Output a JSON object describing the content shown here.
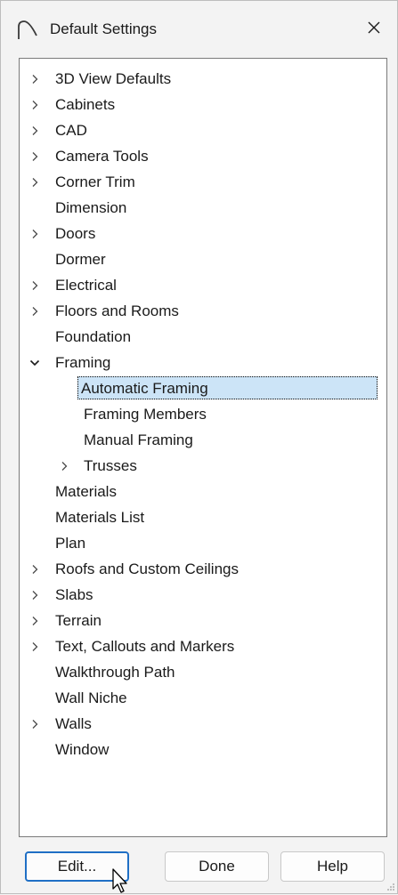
{
  "window": {
    "title": "Default Settings",
    "close_label": "×"
  },
  "tree": {
    "items": [
      {
        "label": "3D View Defaults",
        "expandable": true,
        "expanded": false,
        "level": 0
      },
      {
        "label": "Cabinets",
        "expandable": true,
        "expanded": false,
        "level": 0
      },
      {
        "label": "CAD",
        "expandable": true,
        "expanded": false,
        "level": 0
      },
      {
        "label": "Camera Tools",
        "expandable": true,
        "expanded": false,
        "level": 0
      },
      {
        "label": "Corner Trim",
        "expandable": true,
        "expanded": false,
        "level": 0
      },
      {
        "label": "Dimension",
        "expandable": false,
        "expanded": false,
        "level": 0
      },
      {
        "label": "Doors",
        "expandable": true,
        "expanded": false,
        "level": 0
      },
      {
        "label": "Dormer",
        "expandable": false,
        "expanded": false,
        "level": 0
      },
      {
        "label": "Electrical",
        "expandable": true,
        "expanded": false,
        "level": 0
      },
      {
        "label": "Floors and Rooms",
        "expandable": true,
        "expanded": false,
        "level": 0
      },
      {
        "label": "Foundation",
        "expandable": false,
        "expanded": false,
        "level": 0
      },
      {
        "label": "Framing",
        "expandable": true,
        "expanded": true,
        "level": 0
      },
      {
        "label": "Automatic Framing",
        "expandable": false,
        "expanded": false,
        "level": 1,
        "selected": true
      },
      {
        "label": "Framing Members",
        "expandable": false,
        "expanded": false,
        "level": 1
      },
      {
        "label": "Manual Framing",
        "expandable": false,
        "expanded": false,
        "level": 1
      },
      {
        "label": "Trusses",
        "expandable": true,
        "expanded": false,
        "level": 1
      },
      {
        "label": "Materials",
        "expandable": false,
        "expanded": false,
        "level": 0
      },
      {
        "label": "Materials List",
        "expandable": false,
        "expanded": false,
        "level": 0
      },
      {
        "label": "Plan",
        "expandable": false,
        "expanded": false,
        "level": 0
      },
      {
        "label": "Roofs and Custom Ceilings",
        "expandable": true,
        "expanded": false,
        "level": 0
      },
      {
        "label": "Slabs",
        "expandable": true,
        "expanded": false,
        "level": 0
      },
      {
        "label": "Terrain",
        "expandable": true,
        "expanded": false,
        "level": 0
      },
      {
        "label": "Text, Callouts and Markers",
        "expandable": true,
        "expanded": false,
        "level": 0
      },
      {
        "label": "Walkthrough Path",
        "expandable": false,
        "expanded": false,
        "level": 0
      },
      {
        "label": "Wall Niche",
        "expandable": false,
        "expanded": false,
        "level": 0
      },
      {
        "label": "Walls",
        "expandable": true,
        "expanded": false,
        "level": 0
      },
      {
        "label": "Window",
        "expandable": false,
        "expanded": false,
        "level": 0
      }
    ]
  },
  "buttons": {
    "edit_label": "Edit...",
    "done_label": "Done",
    "help_label": "Help"
  },
  "colors": {
    "selection_bg": "#cce4f7",
    "default_button_border": "#1f6fc5"
  }
}
